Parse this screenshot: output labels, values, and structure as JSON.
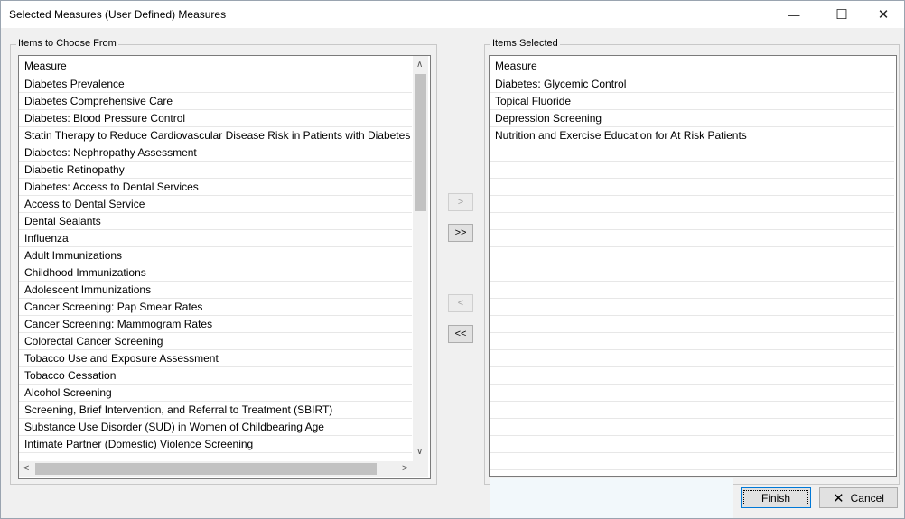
{
  "window": {
    "title": "Selected Measures (User Defined) Measures",
    "minimize_glyph": "—",
    "maximize_glyph": "☐",
    "close_glyph": "✕"
  },
  "available": {
    "group_label": "Items to Choose From",
    "column_header": "Measure",
    "items": [
      "Diabetes Prevalence",
      "Diabetes Comprehensive Care",
      "Diabetes: Blood Pressure Control",
      "Statin Therapy to Reduce Cardiovascular Disease Risk in Patients with Diabetes",
      "Diabetes: Nephropathy Assessment",
      "Diabetic Retinopathy",
      "Diabetes: Access to Dental Services",
      "Access to Dental Service",
      "Dental Sealants",
      "Influenza",
      "Adult Immunizations",
      "Childhood Immunizations",
      "Adolescent Immunizations",
      "Cancer Screening: Pap Smear Rates",
      "Cancer Screening: Mammogram Rates",
      "Colorectal Cancer Screening",
      "Tobacco Use and Exposure Assessment",
      "Tobacco Cessation",
      "Alcohol Screening",
      "Screening, Brief Intervention, and Referral to Treatment (SBIRT)",
      "Substance Use Disorder (SUD) in Women of Childbearing Age",
      "Intimate Partner (Domestic) Violence Screening"
    ]
  },
  "selected": {
    "group_label": "Items Selected",
    "column_header": "Measure",
    "items": [
      "Diabetes: Glycemic Control",
      "Topical Fluoride",
      "Depression Screening",
      "Nutrition and Exercise Education for At Risk Patients"
    ]
  },
  "transfer": {
    "add_one": ">",
    "add_all": ">>",
    "remove_one": "<",
    "remove_all": "<<"
  },
  "footer": {
    "finish_label": "Finish",
    "cancel_label": "Cancel",
    "cancel_glyph": "✕"
  }
}
